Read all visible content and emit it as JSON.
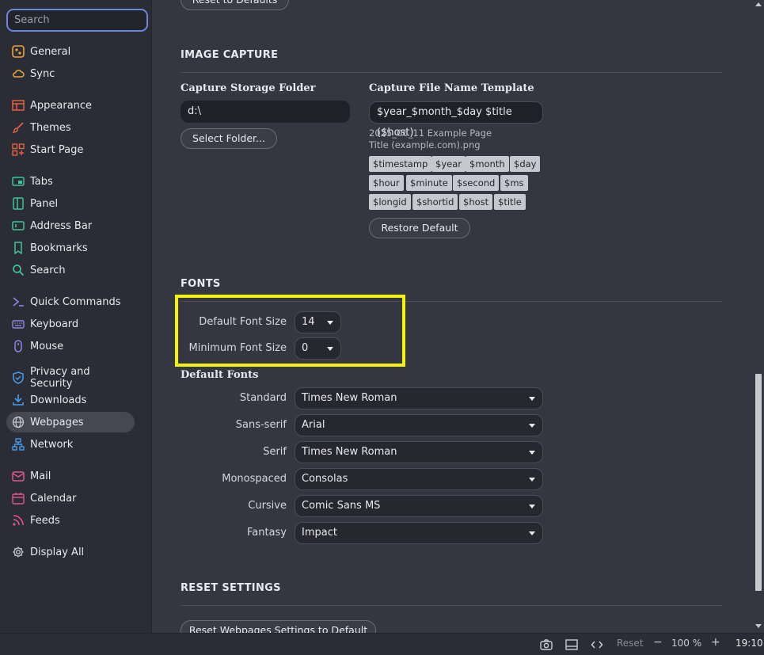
{
  "sidebar": {
    "search_placeholder": "Search",
    "items": [
      {
        "label": "General",
        "icon": "general-icon"
      },
      {
        "label": "Sync",
        "icon": "cloud-icon"
      },
      {
        "label": "Appearance",
        "icon": "appearance-icon"
      },
      {
        "label": "Themes",
        "icon": "brush-icon"
      },
      {
        "label": "Start Page",
        "icon": "start-page-icon"
      },
      {
        "label": "Tabs",
        "icon": "tabs-icon"
      },
      {
        "label": "Panel",
        "icon": "panel-icon"
      },
      {
        "label": "Address Bar",
        "icon": "address-bar-icon"
      },
      {
        "label": "Bookmarks",
        "icon": "bookmark-icon"
      },
      {
        "label": "Search",
        "icon": "search-icon"
      },
      {
        "label": "Quick Commands",
        "icon": "quick-commands-icon"
      },
      {
        "label": "Keyboard",
        "icon": "keyboard-icon"
      },
      {
        "label": "Mouse",
        "icon": "mouse-icon"
      },
      {
        "label": "Privacy and Security",
        "icon": "shield-icon"
      },
      {
        "label": "Downloads",
        "icon": "download-icon"
      },
      {
        "label": "Webpages",
        "icon": "globe-icon"
      },
      {
        "label": "Network",
        "icon": "network-icon"
      },
      {
        "label": "Mail",
        "icon": "mail-icon"
      },
      {
        "label": "Calendar",
        "icon": "calendar-icon"
      },
      {
        "label": "Feeds",
        "icon": "feeds-icon"
      },
      {
        "label": "Display All",
        "icon": "gear-icon"
      }
    ],
    "active": "Webpages"
  },
  "main": {
    "top_button": "Reset to Defaults",
    "image_capture": {
      "title": "IMAGE CAPTURE",
      "storage_label": "Capture Storage Folder",
      "storage_value": "d:\\",
      "select_folder": "Select Folder...",
      "template_label": "Capture File Name Template",
      "template_value": "$year_$month_$day $title ($host)",
      "example_line1": "2025_06_11 Example Page",
      "example_line2": "Title (example.com).png",
      "tokens": [
        "$timestamp",
        "$year",
        "$month",
        "$day",
        "$hour",
        "$minute",
        "$second",
        "$ms",
        "$longid",
        "$shortid",
        "$host",
        "$title"
      ],
      "restore_default": "Restore Default"
    },
    "fonts": {
      "title": "FONTS",
      "default_size_label": "Default Font Size",
      "default_size_value": "14",
      "min_size_label": "Minimum Font Size",
      "min_size_value": "0",
      "default_fonts_label": "Default Fonts",
      "rows": [
        {
          "label": "Standard",
          "value": "Times New Roman"
        },
        {
          "label": "Sans-serif",
          "value": "Arial"
        },
        {
          "label": "Serif",
          "value": "Times New Roman"
        },
        {
          "label": "Monospaced",
          "value": "Consolas"
        },
        {
          "label": "Cursive",
          "value": "Comic Sans MS"
        },
        {
          "label": "Fantasy",
          "value": "Impact"
        }
      ]
    },
    "reset": {
      "title": "RESET SETTINGS",
      "button": "Reset Webpages Settings to Default"
    }
  },
  "statusbar": {
    "reset": "Reset",
    "zoom": "100 %",
    "time": "19:10"
  },
  "colors": {
    "highlight": "#f2f20a",
    "accent": "#6d86d6"
  }
}
